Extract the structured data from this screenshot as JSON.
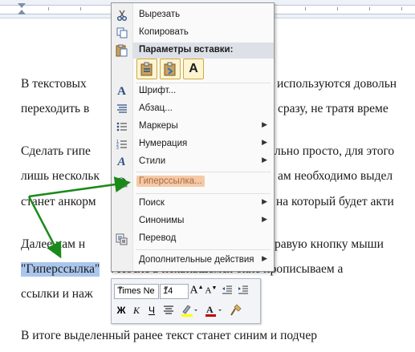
{
  "document": {
    "lines": [
      "В   текстовых",
      "используются   довольн",
      "переходить в",
      "сразу, не тратя време",
      "Сделать гипе",
      "льно просто, для этого",
      "лишь нескольк",
      "ам необходимо выдел",
      "станет анкорм",
      "на который будет акти",
      "Далее   нам   н",
      "равую  кнопку  мыши",
      "\"Гиперссылка\"",
      ". После в появившемся окне прописываем а",
      "ссылки и наж",
      "В  итоге  выделенный  ранее  текст  станет  синим  и  подчер"
    ]
  },
  "context_menu": {
    "items": {
      "cut": {
        "label": "Вырезать",
        "icon": "scissors-icon"
      },
      "copy": {
        "label": "Копировать",
        "icon": "copy-icon"
      },
      "paste_header": "Параметры вставки:",
      "font": {
        "label": "Шрифт...",
        "icon": "font-icon"
      },
      "paragraph": {
        "label": "Абзац...",
        "icon": "paragraph-icon"
      },
      "bullets": {
        "label": "Маркеры",
        "icon": "bullets-icon"
      },
      "numbering": {
        "label": "Нумерация",
        "icon": "numbering-icon"
      },
      "styles": {
        "label": "Стили",
        "icon": "styles-icon"
      },
      "hyperlink": {
        "label": "Гиперссылка...",
        "icon": "hyperlink-globe-icon"
      },
      "search": {
        "label": "Поиск"
      },
      "synonyms": {
        "label": "Синонимы"
      },
      "translate": {
        "label": "Перевод",
        "icon": "translate-icon"
      },
      "more_actions": {
        "label": "Дополнительные действия"
      }
    },
    "paste_icons": [
      "paste-keep-formatting-icon",
      "paste-merge-formatting-icon",
      "paste-text-only-icon"
    ],
    "highlight_color": "#f6c9a6"
  },
  "mini_toolbar": {
    "font_name": "Times Ne",
    "font_size": "14",
    "bold": "Ж",
    "italic": "К",
    "underline": "Ч",
    "text_color": "#c00000",
    "highlight_color": "#ffff00"
  },
  "annotation": {
    "arrow_color": "#1a8a1a"
  }
}
